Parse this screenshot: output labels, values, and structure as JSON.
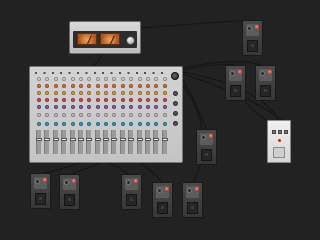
{
  "canvas": {
    "background": "#222222",
    "cable_color": "#151515"
  },
  "amp_head": {
    "icon": "preamp-head-icon",
    "meter_color": "#e8823a"
  },
  "mixer": {
    "label": "",
    "channel_count": 16,
    "knob_row_colors": [
      "#d8d8d8",
      "#e07a2e",
      "#e3a23a",
      "#d94a6a",
      "#8e5fb0",
      "#c8c8c8",
      "#2fa5c9"
    ]
  },
  "modules": [
    {
      "name": "module-top-right"
    },
    {
      "name": "module-right-1"
    },
    {
      "name": "module-right-2"
    },
    {
      "name": "module-mid"
    },
    {
      "name": "module-bottom-1"
    },
    {
      "name": "module-bottom-2"
    },
    {
      "name": "module-bottom-3"
    },
    {
      "name": "module-bottom-4"
    },
    {
      "name": "module-bottom-5"
    }
  ],
  "utility_module": {
    "label": "",
    "icon": "utility-box-icon"
  }
}
